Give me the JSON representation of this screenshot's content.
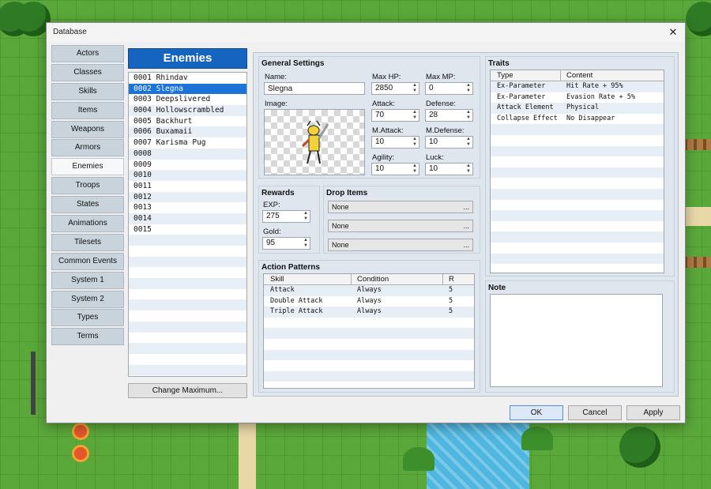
{
  "window": {
    "title": "Database",
    "close_glyph": "✕"
  },
  "categories": [
    "Actors",
    "Classes",
    "Skills",
    "Items",
    "Weapons",
    "Armors",
    "Enemies",
    "Troops",
    "States",
    "Animations",
    "Tilesets",
    "Common Events",
    "System 1",
    "System 2",
    "Types",
    "Terms"
  ],
  "selected_category": "Enemies",
  "list": {
    "header": "Enemies",
    "items": [
      "0001 Rhindav",
      "0002 Slegna",
      "0003 Deepslivered",
      "0004 Hollowscrambled",
      "0005 Backhurt",
      "0006 Buxamaii",
      "0007 Karisma Pug",
      "0008",
      "0009",
      "0010",
      "0011",
      "0012",
      "0013",
      "0014",
      "0015"
    ],
    "selected_index": 1,
    "change_max_label": "Change Maximum..."
  },
  "general": {
    "title": "General Settings",
    "name_label": "Name:",
    "name_value": "Slegna",
    "image_label": "Image:",
    "maxhp_label": "Max HP:",
    "maxhp": "2850",
    "maxmp_label": "Max MP:",
    "maxmp": "0",
    "attack_label": "Attack:",
    "attack": "70",
    "defense_label": "Defense:",
    "defense": "28",
    "mattack_label": "M.Attack:",
    "mattack": "10",
    "mdefense_label": "M.Defense:",
    "mdefense": "10",
    "agility_label": "Agility:",
    "agility": "10",
    "luck_label": "Luck:",
    "luck": "10"
  },
  "rewards": {
    "title": "Rewards",
    "exp_label": "EXP:",
    "exp": "275",
    "gold_label": "Gold:",
    "gold": "95"
  },
  "drops": {
    "title": "Drop Items",
    "items": [
      "None",
      "None",
      "None"
    ],
    "dots": "..."
  },
  "actions": {
    "title": "Action Patterns",
    "columns": [
      "Skill",
      "Condition",
      "R"
    ],
    "rows": [
      {
        "skill": "Attack",
        "condition": "Always",
        "r": "5"
      },
      {
        "skill": "Double Attack",
        "condition": "Always",
        "r": "5"
      },
      {
        "skill": "Triple Attack",
        "condition": "Always",
        "r": "5"
      }
    ]
  },
  "traits": {
    "title": "Traits",
    "columns": [
      "Type",
      "Content"
    ],
    "rows": [
      {
        "type": "Ex-Parameter",
        "content": "Hit Rate + 95%"
      },
      {
        "type": "Ex-Parameter",
        "content": "Evasion Rate + 5%"
      },
      {
        "type": "Attack Element",
        "content": "Physical"
      },
      {
        "type": "Collapse Effect",
        "content": "No Disappear"
      }
    ]
  },
  "note": {
    "title": "Note",
    "value": ""
  },
  "buttons": {
    "ok": "OK",
    "cancel": "Cancel",
    "apply": "Apply"
  },
  "colors": {
    "accent": "#1565c0",
    "selection": "#1c74d9",
    "grass": "#5aa83a"
  }
}
